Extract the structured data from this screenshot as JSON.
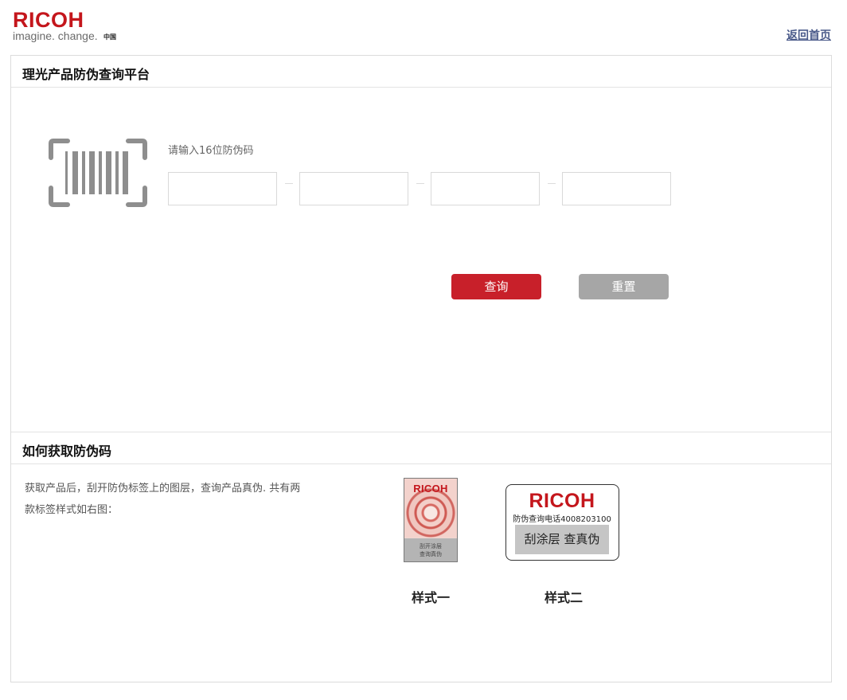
{
  "header": {
    "brand": "RICOH",
    "tagline": "imagine. change.",
    "region": "中国",
    "home_link": "返回首页"
  },
  "query_section": {
    "title": "理光产品防伪查询平台",
    "input_label": "请输入16位防伪码",
    "code_inputs": [
      "",
      "",
      "",
      ""
    ],
    "query_button": "查询",
    "reset_button": "重置"
  },
  "help_section": {
    "title": "如何获取防伪码",
    "description": "获取产品后，刮开防伪标签上的图层，查询产品真伪. 共有两款标签样式如右图：",
    "style_one": {
      "brand": "RICOH",
      "scratch_text_line1": "刮开涂层",
      "scratch_text_line2": "查询真伪",
      "caption": "样式一"
    },
    "style_two": {
      "brand": "RICOH",
      "phone_text": "防伪查询电话4008203100",
      "scratch_text": "刮涂层 查真伪",
      "caption": "样式二"
    }
  },
  "colors": {
    "brand_red": "#c4161c",
    "query_button": "#c8202a",
    "reset_button": "#a6a6a6",
    "link": "#4a5a8a"
  }
}
